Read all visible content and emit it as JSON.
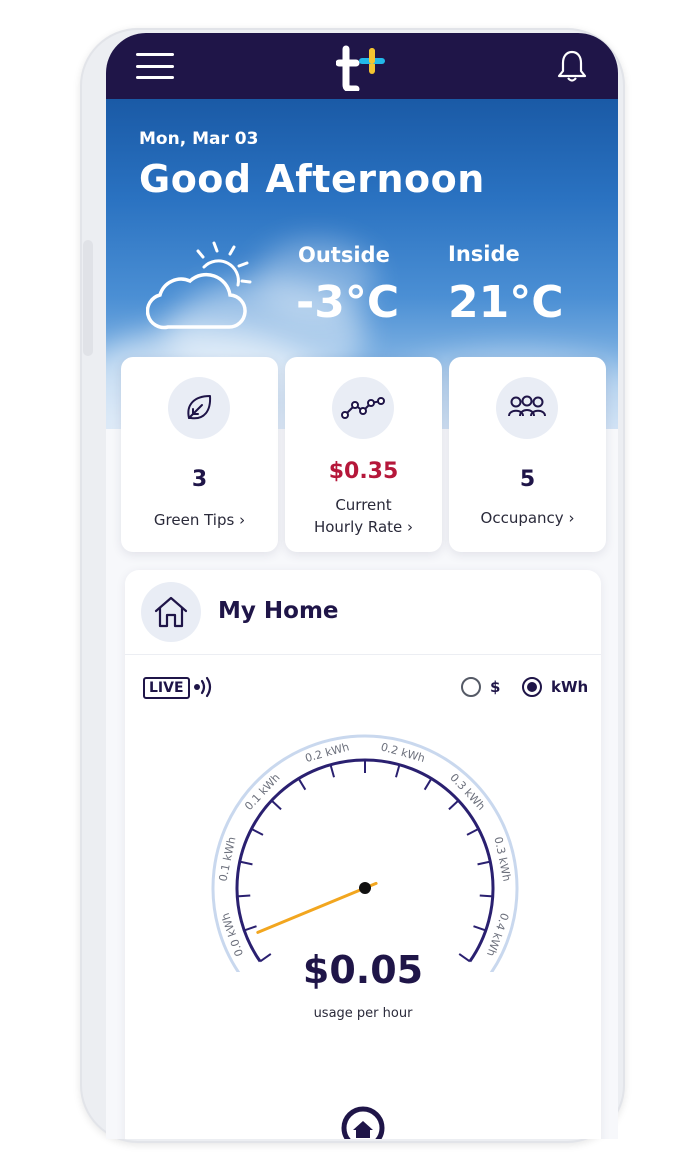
{
  "header": {
    "logo_text": "t+",
    "menu_icon": "hamburger-menu-icon",
    "notification_icon": "bell-icon"
  },
  "hero": {
    "date": "Mon, Mar 03",
    "greeting": "Good Afternoon",
    "weather_icon": "partly-cloudy-icon",
    "outside": {
      "label": "Outside",
      "value": "-3°C"
    },
    "inside": {
      "label": "Inside",
      "value": "21°C"
    }
  },
  "stats": [
    {
      "icon": "leaf-icon",
      "value": "3",
      "label": "Green Tips ›"
    },
    {
      "icon": "trend-line-icon",
      "value": "$0.35",
      "label_line1": "Current",
      "label_line2": "Hourly Rate ›"
    },
    {
      "icon": "people-icon",
      "value": "5",
      "label": "Occupancy ›"
    }
  ],
  "home": {
    "title": "My Home",
    "icon": "house-icon",
    "live_badge": "LIVE",
    "units": {
      "options": [
        "$",
        "kWh"
      ],
      "selected": "kWh"
    },
    "gauge": {
      "tick_labels": [
        "0.0 kWh",
        "0.1 kWh",
        "0.1 kWh",
        "0.2 kWh",
        "0.2 kWh",
        "0.3 kWh",
        "0.3 kWh",
        "0.4 kWh"
      ],
      "value": 0.02,
      "max": 0.4
    },
    "usage_value": "$0.05",
    "usage_label": "usage per hour"
  },
  "colors": {
    "primary": "#1f1548",
    "rate": "#b5173a",
    "needle": "#f2a61f",
    "logo_plus_yellow": "#f4c430",
    "logo_plus_cyan": "#22b8e8"
  }
}
